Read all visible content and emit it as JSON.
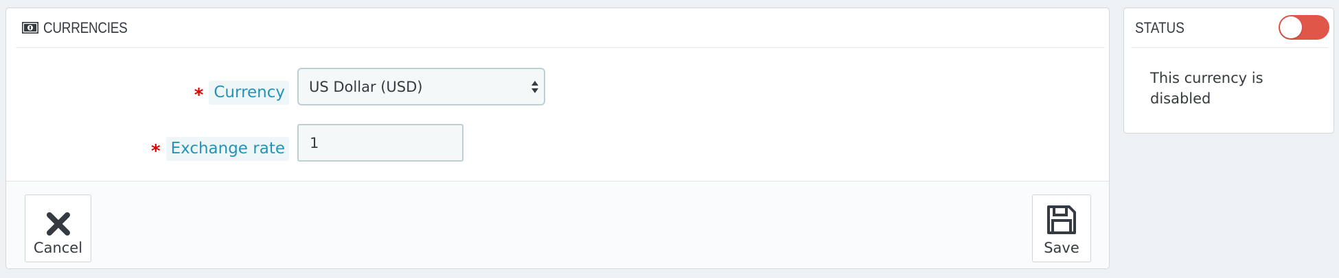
{
  "currencies_panel": {
    "title": "CURRENCIES",
    "icon": "money-bill-icon",
    "fields": {
      "currency": {
        "required_mark": "*",
        "label": "Currency",
        "selected_value": "US Dollar (USD)"
      },
      "exchange_rate": {
        "required_mark": "*",
        "label": "Exchange rate",
        "value": "1"
      }
    },
    "footer": {
      "cancel_label": "Cancel",
      "cancel_icon": "close-icon",
      "save_label": "Save",
      "save_icon": "floppy-disk-icon"
    }
  },
  "status_panel": {
    "title": "STATUS",
    "toggle_enabled": false,
    "toggle_color": "#e0574a",
    "message": "This currency is disabled"
  },
  "colors": {
    "label_blue": "#2493b8",
    "required_red": "#e10000",
    "background": "#eef1f3"
  }
}
